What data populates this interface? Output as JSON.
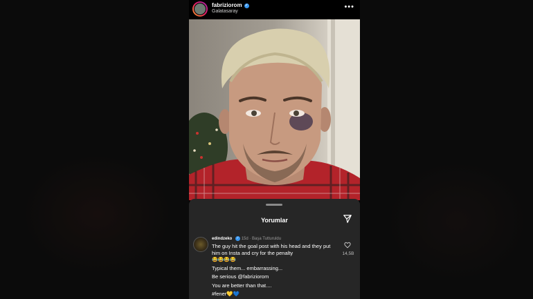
{
  "post": {
    "username": "fabriziorom",
    "location": "Galatasaray",
    "more_label": "•••"
  },
  "comments_sheet": {
    "title": "Yorumlar"
  },
  "comment": {
    "username": "edindzeko",
    "time": "15d",
    "meta": "Başa Tutturuldu",
    "lines": [
      "The guy hit the goal post with his head and they put him on Insta and cry for the penalty",
      "😂😂😂😂",
      "Typical them... embarrassing...",
      "Be serious @fabriziorom",
      "You are better than that....",
      "#fener💛💙"
    ],
    "like_count": "14,5B"
  },
  "colors": {
    "verified": "#3897f0",
    "sheet_bg": "#262626",
    "shirt_red": "#c0262b"
  },
  "icons": [
    "more-icon",
    "send-icon",
    "heart-icon",
    "verified-icon"
  ]
}
